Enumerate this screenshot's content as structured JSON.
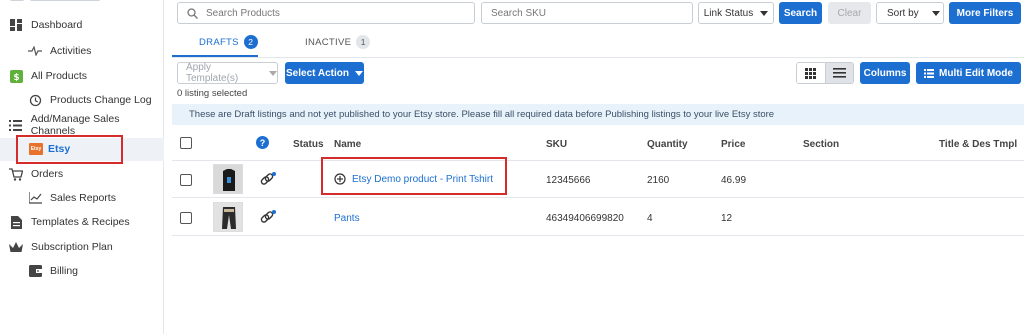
{
  "sidebar": {
    "dashboard": "Dashboard",
    "activities": "Activities",
    "all_products": "All Products",
    "products_change_log": "Products Change Log",
    "add_manage": "Add/Manage Sales Channels",
    "etsy_logo_text": "Etsy",
    "etsy": "Etsy",
    "orders": "Orders",
    "sales_reports": "Sales Reports",
    "templates": "Templates & Recipes",
    "subscription": "Subscription Plan",
    "billing": "Billing"
  },
  "toolbar": {
    "search_products_placeholder": "Search Products",
    "search_sku_placeholder": "Search SKU",
    "link_status": "Link Status",
    "search": "Search",
    "clear": "Clear",
    "sort_by": "Sort by",
    "more_filters": "More Filters"
  },
  "tabs": [
    {
      "label": "DRAFTS",
      "count": "2"
    },
    {
      "label": "INACTIVE",
      "count": "1"
    }
  ],
  "actions": {
    "apply_template_placeholder": "Apply Template(s)",
    "select_action": "Select Action",
    "columns": "Columns",
    "multi_edit": "Multi Edit Mode"
  },
  "selection_status": "0 listing selected",
  "notice": "These are Draft listings and not yet published to your Etsy store.  Please fill all required data before Publishing listings to your live Etsy store",
  "table": {
    "headers": {
      "help": "?",
      "status": "Status",
      "name": "Name",
      "sku": "SKU",
      "quantity": "Quantity",
      "price": "Price",
      "section": "Section",
      "title_des": "Title & Des Tmpl"
    },
    "rows": [
      {
        "name": "Etsy Demo product - Print Tshirt",
        "sku": "12345666",
        "quantity": "2160",
        "price": "46.99"
      },
      {
        "name": "Pants",
        "sku": "46349406699820",
        "quantity": "4",
        "price": "12"
      }
    ]
  },
  "colors": {
    "accent": "#1c6fd1",
    "highlight": "#d62b2b",
    "etsy": "#e8712c",
    "notice_bg": "#e8f2fb"
  }
}
